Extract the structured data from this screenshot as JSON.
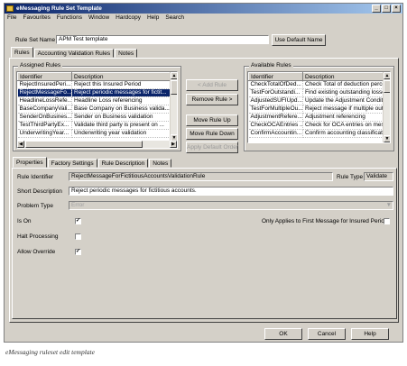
{
  "window": {
    "title": "eMessaging Rule Set Template",
    "controls": [
      "_",
      "□",
      "×"
    ]
  },
  "menu": [
    "File",
    "Favourites",
    "Functions",
    "Window",
    "Hardcopy",
    "Help",
    "Search"
  ],
  "rule_set": {
    "label": "Rule Set Name",
    "value": "APM Test template",
    "default_button": "Use Default Name"
  },
  "top_tabs": [
    "Rules",
    "Accounting Validation Rules",
    "Notes"
  ],
  "assigned": {
    "title": "Assigned Rules",
    "headers": [
      "Identifier",
      "Description"
    ],
    "rows": [
      [
        "RejectInsuredPeri...",
        "Reject this Insured Period"
      ],
      [
        "RejectMessageFo...",
        "Reject periodic messages for fictit..."
      ],
      [
        "HeadlineLossRefe...",
        "Headline Loss referencing"
      ],
      [
        "BaseCompanyVali...",
        "Base Company on Business valida..."
      ],
      [
        "SenderOnBusines...",
        "Sender on Business validation"
      ],
      [
        "TestThirdPartyEx...",
        "Validate third party is present on ..."
      ],
      [
        "UnderwritingYear...",
        "Underwriting year validation"
      ]
    ],
    "selected_index": 1
  },
  "buttons": {
    "add": "< Add Rule",
    "remove": "Remove Rule >",
    "up": "Move Rule Up",
    "down": "Move Rule Down",
    "apply": "Apply Default Order"
  },
  "available": {
    "title": "Available Rules",
    "headers": [
      "Identifier",
      "Description"
    ],
    "rows": [
      [
        "CheckTotalOfDed...",
        "Check Total of deduction percen"
      ],
      [
        "TestForOutstandi...",
        "Find existing outstanding losses"
      ],
      [
        "AdjustedSUFIUpd...",
        "Update the Adjustment Condition"
      ],
      [
        "TestForMultipleOu...",
        "Reject message if multiple outst"
      ],
      [
        "AdjustmentRefere...",
        "Adjustment referencing"
      ],
      [
        "CheckOCAEntries ...",
        "Check for OCA entries on messa"
      ],
      [
        "ConfirmAccountin...",
        "Confirm accounting classification"
      ]
    ]
  },
  "prop_tabs": [
    "Properties",
    "Factory Settings",
    "Rule Description",
    "Notes"
  ],
  "properties": {
    "identifier_label": "Rule Identifier",
    "identifier_value": "RejectMessageForFictitiousAccountsValidationRule",
    "rule_type_label": "Rule Type",
    "rule_type_value": "Validate",
    "short_desc_label": "Short Description",
    "short_desc_value": "Reject periodic messages for fictitious accounts.",
    "problem_type_label": "Problem Type",
    "problem_type_value": "Error",
    "is_on_label": "Is On",
    "halt_label": "Halt Processing",
    "override_label": "Allow Override",
    "first_msg_label": "Only Applies to First Message for Insured Period",
    "check_mark": "✓"
  },
  "footer": {
    "ok": "OK",
    "cancel": "Cancel",
    "help": "Help"
  },
  "caption": "eMessaging ruleset edit template"
}
